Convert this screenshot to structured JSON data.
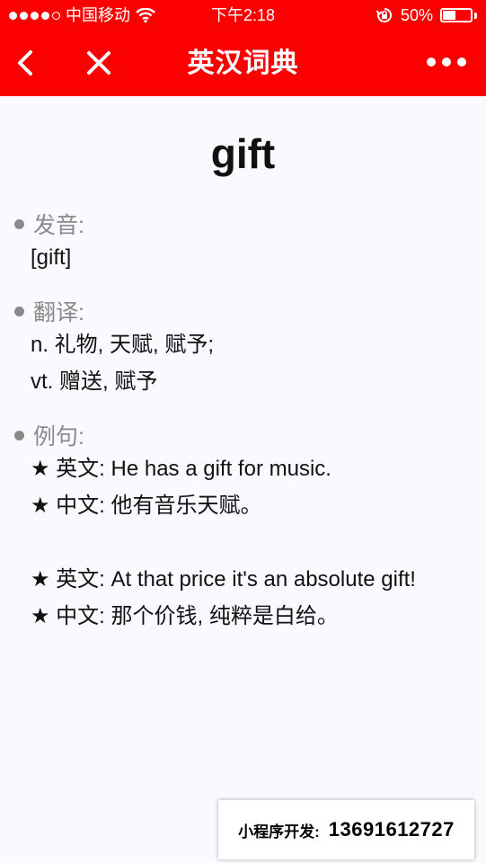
{
  "status_bar": {
    "carrier": "中国移动",
    "time": "下午2:18",
    "battery_text": "50%",
    "battery_level": 0.5,
    "signal_bars_filled": 4,
    "signal_bars_total": 5
  },
  "nav": {
    "title": "英汉词典",
    "back_icon": "chevron-left-icon",
    "close_icon": "close-icon",
    "more_icon": "more-dots-icon"
  },
  "entry": {
    "word": "gift",
    "pronunciation_label": "发音:",
    "pronunciation": "[gift]",
    "translation_label": "翻译:",
    "translations": [
      "n. 礼物, 天赋, 赋予;",
      "vt. 赠送, 赋予"
    ],
    "examples_label": "例句:",
    "examples": [
      {
        "en": "★ 英文: He has a gift for music.",
        "zh": "★ 中文: 他有音乐天赋。"
      },
      {
        "en": "★ 英文: At that price it's an absolute gift!",
        "zh": "★ 中文: 那个价钱, 纯粹是白给。"
      }
    ]
  },
  "footer": {
    "label": "小程序开发:",
    "value": "13691612727"
  },
  "colors": {
    "header_red": "#fb0000",
    "background": "#fbf9fe",
    "label_gray": "#8a8a8a"
  }
}
